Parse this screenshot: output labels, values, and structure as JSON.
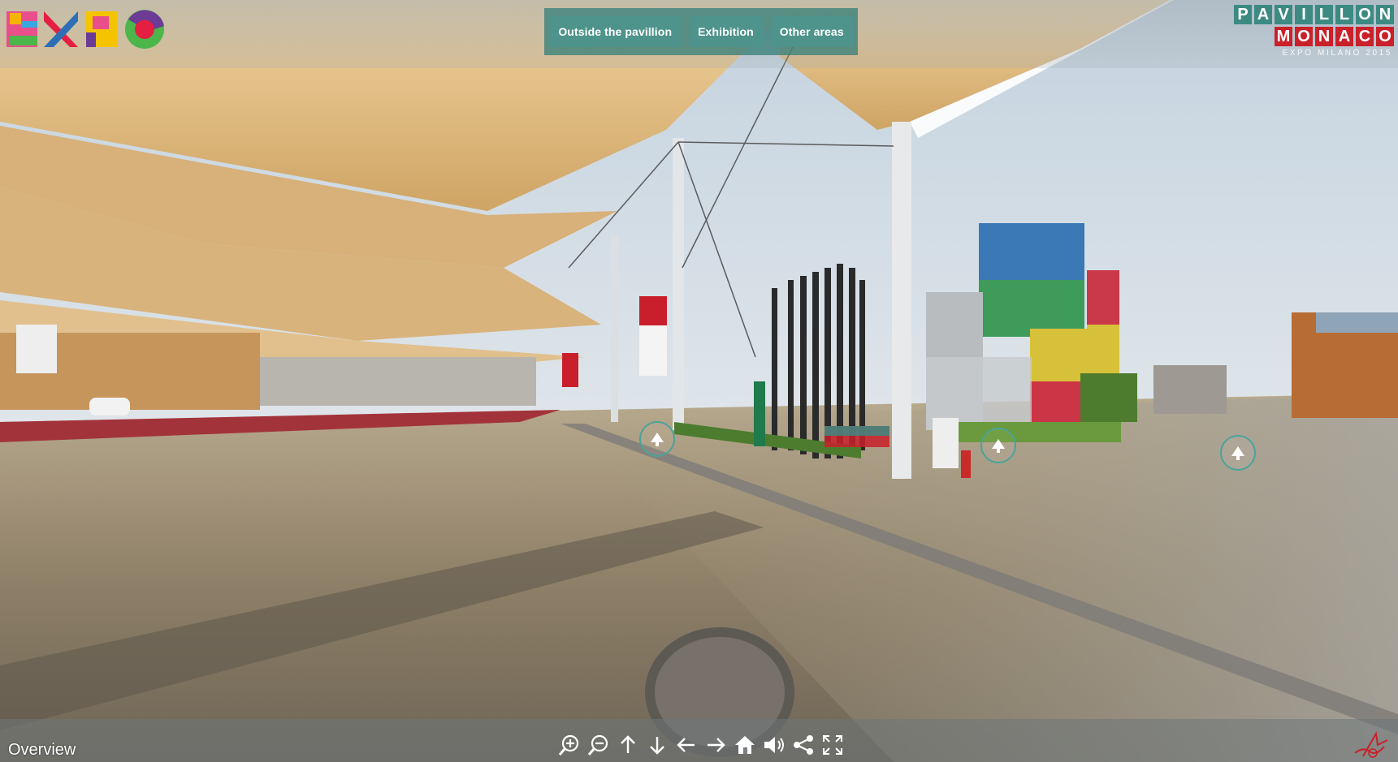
{
  "nav": {
    "items": [
      {
        "label": "Outside the pavillion"
      },
      {
        "label": "Exhibition"
      },
      {
        "label": "Other areas"
      }
    ]
  },
  "brand": {
    "expo_letters": [
      "E",
      "X",
      "P",
      "O"
    ],
    "pavillon_letters": [
      "P",
      "A",
      "V",
      "I",
      "L",
      "L",
      "O",
      "N"
    ],
    "monaco_letters": [
      "M",
      "O",
      "N",
      "A",
      "C",
      "O"
    ],
    "subtitle": "EXPO MILANO 2015",
    "colors": {
      "teal": "#3d8a83",
      "red": "#c9202a"
    }
  },
  "footer": {
    "scene_label": "Overview",
    "controls": [
      "zoom-in-icon",
      "zoom-out-icon",
      "arrow-up-icon",
      "arrow-down-icon",
      "arrow-left-icon",
      "arrow-right-icon",
      "home-icon",
      "sound-icon",
      "share-icon",
      "fullscreen-icon"
    ]
  },
  "hotspots": [
    "arrow-up-icon",
    "arrow-up-icon",
    "arrow-up-icon"
  ]
}
